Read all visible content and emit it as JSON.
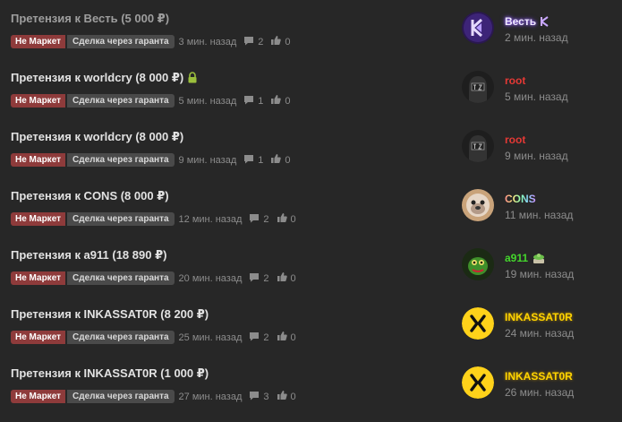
{
  "threads": [
    {
      "title": "Претензия к Весть (5 000 ₽)",
      "tag1": "Не Маркет",
      "tag2": "Сделка через гаранта",
      "time": "3 мин. назад",
      "replies": "2",
      "likes": "0",
      "username": "Весть",
      "user_time": "2 мин. назад",
      "locked": false
    },
    {
      "title": "Претензия к worldcry (8 000 ₽)",
      "tag1": "Не Маркет",
      "tag2": "Сделка через гаранта",
      "time": "5 мин. назад",
      "replies": "1",
      "likes": "0",
      "username": "root",
      "user_time": "5 мин. назад",
      "locked": true
    },
    {
      "title": "Претензия к worldcry (8 000 ₽)",
      "tag1": "Не Маркет",
      "tag2": "Сделка через гаранта",
      "time": "9 мин. назад",
      "replies": "1",
      "likes": "0",
      "username": "root",
      "user_time": "9 мин. назад",
      "locked": false
    },
    {
      "title": "Претензия к CONS (8 000 ₽)",
      "tag1": "Не Маркет",
      "tag2": "Сделка через гаранта",
      "time": "12 мин. назад",
      "replies": "2",
      "likes": "0",
      "username": "CONS",
      "user_time": "11 мин. назад",
      "locked": false
    },
    {
      "title": "Претензия к a911 (18 890 ₽)",
      "tag1": "Не Маркет",
      "tag2": "Сделка через гаранта",
      "time": "20 мин. назад",
      "replies": "2",
      "likes": "0",
      "username": "a911",
      "user_time": "19 мин. назад",
      "locked": false
    },
    {
      "title": "Претензия к INKASSAT0R (8 200 ₽)",
      "tag1": "Не Маркет",
      "tag2": "Сделка через гаранта",
      "time": "25 мин. назад",
      "replies": "2",
      "likes": "0",
      "username": "INKASSAT0R",
      "user_time": "24 мин. назад",
      "locked": false
    },
    {
      "title": "Претензия к INKASSAT0R (1 000 ₽)",
      "tag1": "Не Маркет",
      "tag2": "Сделка через гаранта",
      "time": "27 мин. назад",
      "replies": "3",
      "likes": "0",
      "username": "INKASSAT0R",
      "user_time": "26 мин. назад",
      "locked": false
    }
  ],
  "colors": {
    "background": "#272727",
    "tag_primary": "#8e3b3b",
    "tag_secondary": "#4a4a4a"
  }
}
